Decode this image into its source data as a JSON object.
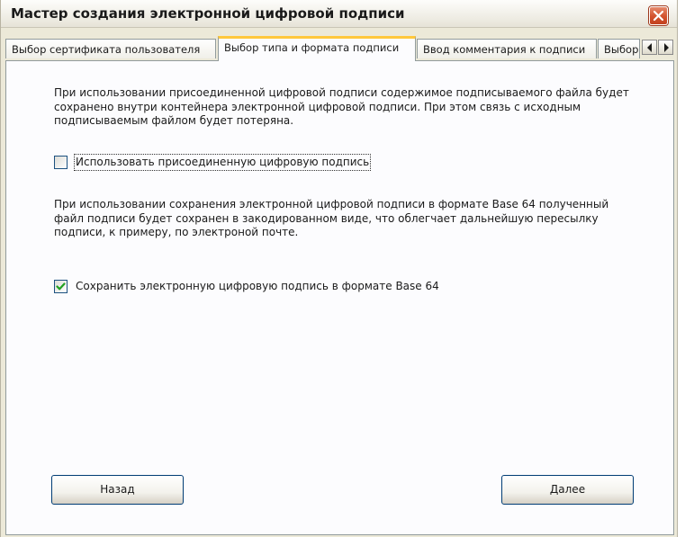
{
  "window": {
    "title": "Мастер создания электронной цифровой подписи"
  },
  "tabs": [
    {
      "label": "Выбор сертификата пользователя",
      "active": false
    },
    {
      "label": "Выбор типа и формата подписи",
      "active": true
    },
    {
      "label": "Ввод комментария к подписи",
      "active": false
    },
    {
      "label": "Выбор",
      "active": false
    }
  ],
  "panel": {
    "attached_description": "При использовании присоединенной цифровой подписи содержимое подписываемого файла будет сохранено внутри контейнера электронной цифровой подписи. При этом связь с исходным подписываемым файлом будет потеряна.",
    "attached_checkbox": {
      "label": "Использовать присоединенную цифровую подпись",
      "checked": false
    },
    "base64_description": "При использовании сохранения электронной цифровой подписи в формате Base 64 полученный файл подписи будет сохранен в закодированном виде, что облегчает дальнейшую пересылку подписи, к примеру, по электроной почте.",
    "base64_checkbox": {
      "label": "Сохранить электронную цифровую подпись в формате Base 64",
      "checked": true
    }
  },
  "buttons": {
    "back": "Назад",
    "next": "Далее"
  },
  "colors": {
    "active_tab_highlight": "#ffc83c",
    "checkmark": "#21a121",
    "close_button": "#d3522d"
  },
  "icons": {
    "close": "close-x-icon",
    "scroll_left": "chevron-left-icon",
    "scroll_right": "chevron-right-icon",
    "check": "checkmark-icon"
  }
}
